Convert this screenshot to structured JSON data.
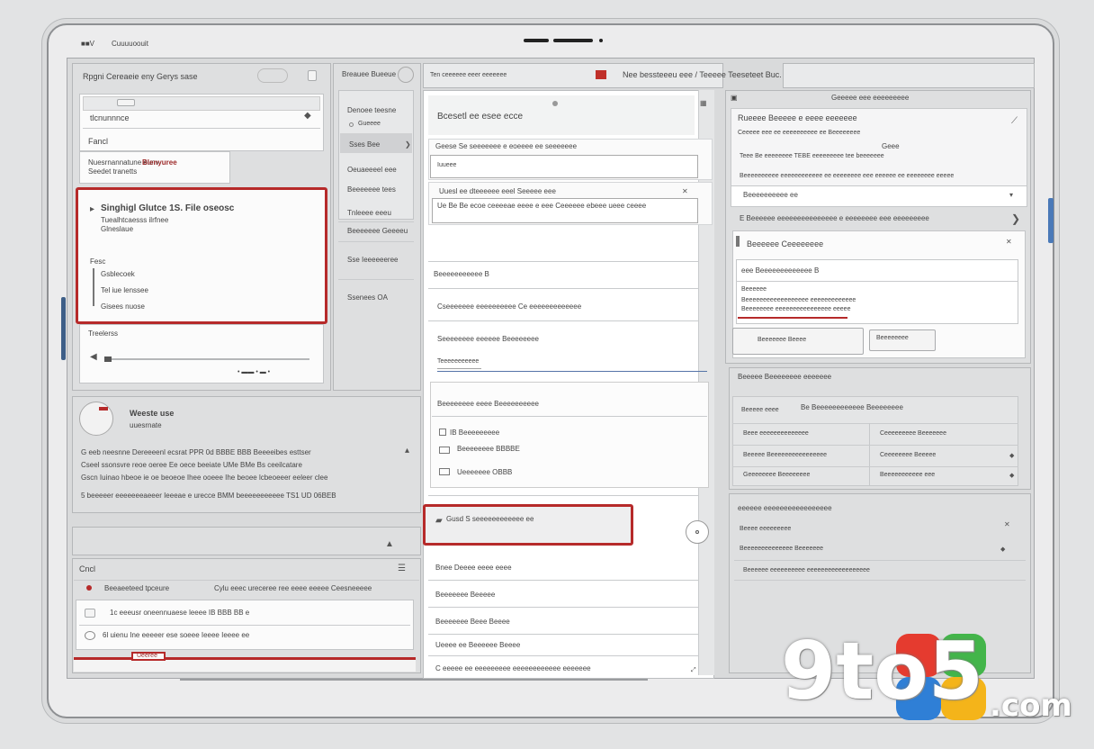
{
  "device": {
    "status_left": "■■V",
    "status_title": "Cuuuuoouit"
  },
  "left_panel": {
    "header_title": "Rpgni Cereaeie eny Gerys sase",
    "tab_label": "tlcnunnnce",
    "row1_label": "Fancl",
    "row2_text": "Nuesrnannatune eunv",
    "row2_highlight": "Blenyuree",
    "row2_sub": "Seedet tranetts",
    "selected_title": "Singhigl Glutce 1S. File oseosc",
    "selected_sub1": "Tuealhtcaesss ilrfnee",
    "selected_sub2": "Glneslaue",
    "selected_label": "Fesc",
    "selected_items": [
      "Gsblecoek",
      "Tel iue lenssee",
      "Gisees nuose"
    ],
    "slider_label": "Treelerss",
    "comment_author": "Weeste use",
    "comment_meta": "uuesrnate",
    "comment_lines": [
      "G eeb neesnne Dereeeenl ecsrat PPR 0d BBBE BBB Beeeeibes esttser",
      "Cseel ssonsvre reoe oeree Ee oece beeiate UMe BMe Bs ceeilcatare",
      "Gscn Iuinao hbeoe ie oe beoeoe Ihee ooeee Ihe beoee lcbeoeeer eeleer clee",
      "5 beeeeer eeeeeeeaeeer Ieeeae e urecce BMM beeeeeeeeeee TS1 UD 06BEB"
    ],
    "section2_title": "Cncl",
    "list_header_left": "Beeaeeteed tpceure",
    "list_header_right": "Cylu eeec ureceree ree eeee eeeee Ceesneeeee",
    "list_items": [
      "1c eeeusr oneennuaese leeee IB BBB BB e",
      "6l uienu Ine eeeeer ese soeee Ieeee Ieeee ee"
    ],
    "list_footer": "Ueeree"
  },
  "mid_nav": {
    "header": "Breauee Bueeue",
    "items": [
      "Denoee teesne",
      "Gueeee",
      "Sses Bee",
      "Oeuaeeeel eee",
      "Beeeeeee tees",
      "Tnleeee eeeu",
      "Beeeeeee Geeeeu",
      "Sse Ieeeeeeree",
      "Ssenees OA"
    ]
  },
  "main": {
    "header_title": "Ten ceeeeee eeer eeeeeee",
    "toolbar_title": "Nee bessteeeu eee / Teeeee Teeseteet Buc. Beeeseees",
    "card_title": "Bcesetl ee esee ecce",
    "field1_label": "Geese Se seeeeeee e eoeeee ee seeeeeee",
    "field1_value": "Iuueee",
    "field2_label": "Uuesl ee dteeeeee eeel Seeeee eee",
    "field2_value": "Ue Be Be ecoe ceeeeae eeee e eee Ceeeeee ebeee ueee ceeee",
    "section_title": "Beeeeeeeeeee B",
    "row1": "Cseeeeeee eeeeeeeeee Ce eeeeeeeeeeeee",
    "row2": "Seeeeeeee eeeeee Beeeeeeee",
    "row2_sub": "Teeeeeeeeeee",
    "subcard_title": "Beeeeeeee eeee Beeeeeeeeee",
    "subcard_items": [
      "IB Beeeeeeeee",
      "Beeeeeeee BBBBE",
      "Ueeeeeee OBBB"
    ],
    "active_row": "Gusd S seeeeeeeeeeee ee",
    "list_rows": [
      "Bnee Deeee eeee eeee",
      "Beeeeeee Beeeee",
      "Beeeeeee Beee Beeee",
      "Ueeee ee Beeeeee Beeee",
      "C eeeee ee eeeeeeeee eeeeeeeeeeee eeeeeee"
    ]
  },
  "right": {
    "header_title": "Geeeee eee eeeeeeeee",
    "card_title": "Rueeee Beeeee e eeee eeeeeee",
    "card_sub": "Ceeeee eee ee eeeeeeeeee ee Beeeeeeee",
    "card_sub2": "Geee",
    "card_desc": "Teee Be eeeeeeee TEBE eeeeeeeee tee beeeeeee",
    "card_desc2": "Beeeeeeeeee eeeeeeeeeeee ee eeeeeeee eee eeeeee ee eeeeeeee eeeee",
    "input_value": "Beeeeeeeeee ee",
    "info_row": "E Beeeeee eeeeeeeeeeeeeee e eeeeeeee eee eeeeeeeee",
    "dialog_title": "Beeeeee Ceeeeeeee",
    "dialog_field_label": "eee Beeeeeeeeeeeee B",
    "dialog_sub": "Beeeeee",
    "dialog_desc1": "Beeeeeeeeeeeeeeeeee eeeeeeeeeeeee",
    "dialog_desc2": "Beeeeeeee eeeeeeeeeeeeeeee eeeee",
    "dialog_btn_primary": "Beeeeeee Beeee",
    "dialog_btn_secondary": "Beeeeeeee",
    "table_title": "Beeeee Beeeeeeee eeeeeee",
    "table_header_sub": "Be Beeeeeeeeeeee Beeeeeeee",
    "table_header_left": "Beeeee eeee",
    "table_rows": [
      [
        "Beee eeeeeeeeeeeeee",
        "Ceeeeeeeee Beeeeeee"
      ],
      [
        "Beeeee Beeeeeeeeeeeeeeee",
        "Ceeeeeeee Beeeee"
      ],
      [
        "Geeeeeeee Beeeeeeee",
        "Beeeeeeeeeee eee"
      ]
    ],
    "bottom_title": "eeeeee eeeeeeeeeeeeeeeee",
    "bottom_items": [
      "Beeee eeeeeeeee",
      "Beeeeeeeeeeeeee Beeeeeee",
      "Beeeeee eeeeeeeeee eeeeeeeeeeeeeeeeee"
    ]
  },
  "watermark": {
    "main": "9to5",
    "suffix": ".com"
  }
}
